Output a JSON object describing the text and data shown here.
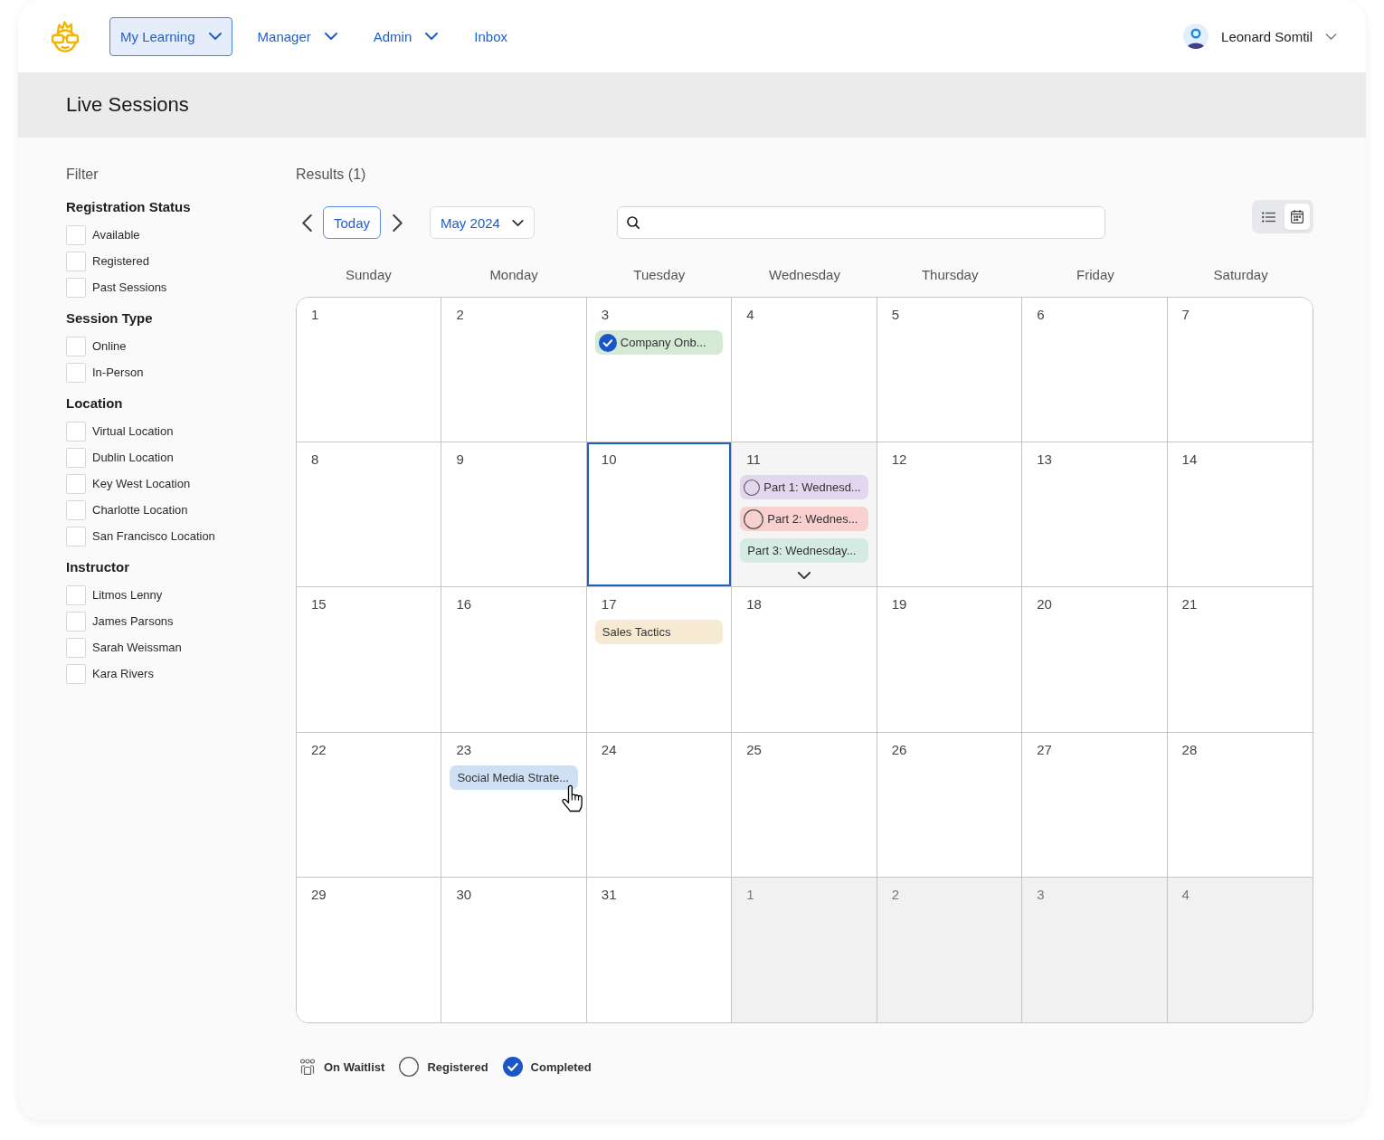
{
  "nav": {
    "items": [
      {
        "label": "My Learning",
        "dropdown": true,
        "selected": true
      },
      {
        "label": "Manager",
        "dropdown": true,
        "selected": false
      },
      {
        "label": "Admin",
        "dropdown": true,
        "selected": false
      },
      {
        "label": "Inbox",
        "dropdown": false,
        "selected": false
      }
    ],
    "user": {
      "name": "Leonard Somtil"
    }
  },
  "header": {
    "title": "Live Sessions"
  },
  "filter": {
    "heading": "Filter",
    "groups": [
      {
        "title": "Registration Status",
        "options": [
          {
            "label": "Available",
            "checked": false
          },
          {
            "label": "Registered",
            "checked": false
          },
          {
            "label": "Past Sessions",
            "checked": false
          }
        ]
      },
      {
        "title": "Session Type",
        "options": [
          {
            "label": "Online",
            "checked": false
          },
          {
            "label": "In-Person",
            "checked": false
          }
        ]
      },
      {
        "title": "Location",
        "options": [
          {
            "label": "Virtual Location",
            "checked": false
          },
          {
            "label": "Dublin Location",
            "checked": false
          },
          {
            "label": "Key West Location",
            "checked": false
          },
          {
            "label": "Charlotte Location",
            "checked": false
          },
          {
            "label": "San Francisco Location",
            "checked": false
          }
        ]
      },
      {
        "title": "Instructor",
        "options": [
          {
            "label": "Litmos Lenny",
            "checked": false
          },
          {
            "label": "James Parsons",
            "checked": false
          },
          {
            "label": "Sarah Weissman",
            "checked": false
          },
          {
            "label": "Kara Rivers",
            "checked": false
          }
        ]
      }
    ]
  },
  "results": {
    "heading": "Results (1)"
  },
  "toolbar": {
    "today": "Today",
    "month": "May 2024",
    "views": [
      {
        "kind": "list",
        "selected": false
      },
      {
        "kind": "calendar",
        "selected": true
      }
    ]
  },
  "calendar": {
    "weekdays": [
      "Sunday",
      "Monday",
      "Tuesday",
      "Wednesday",
      "Thursday",
      "Friday",
      "Saturday"
    ],
    "weeks": [
      {
        "days": [
          {
            "day": "1",
            "other_month": false,
            "selected": false,
            "more": false
          },
          {
            "day": "2",
            "other_month": false,
            "selected": false,
            "more": false
          },
          {
            "day": "3",
            "other_month": false,
            "selected": false,
            "more": false,
            "events": [
              {
                "title": "Company Onb...",
                "color": "#d4ead4",
                "kind": "completed",
                "hovered": false
              }
            ]
          },
          {
            "day": "4",
            "other_month": false,
            "selected": false,
            "more": false
          },
          {
            "day": "5",
            "other_month": false,
            "selected": false,
            "more": false
          },
          {
            "day": "6",
            "other_month": false,
            "selected": false,
            "more": false
          },
          {
            "day": "7",
            "other_month": false,
            "selected": false,
            "more": false
          }
        ]
      },
      {
        "days": [
          {
            "day": "8",
            "other_month": false,
            "selected": false,
            "more": false
          },
          {
            "day": "9",
            "other_month": false,
            "selected": false,
            "more": false
          },
          {
            "day": "10",
            "other_month": false,
            "selected": true,
            "more": false
          },
          {
            "day": "11",
            "other_month": false,
            "selected": false,
            "more": true,
            "events": [
              {
                "title": "Part 1: Wednesd...",
                "color": "#e3d7ef",
                "kind": "registered",
                "hovered": false
              },
              {
                "title": "Part 2: Wednes...",
                "color": "#f8d0d0",
                "kind": "registered",
                "hovered": false
              },
              {
                "title": "Part 3: Wednesday...",
                "color": "#d3ebe2",
                "kind": "plain",
                "hovered": false
              }
            ]
          },
          {
            "day": "12",
            "other_month": false,
            "selected": false,
            "more": false
          },
          {
            "day": "13",
            "other_month": false,
            "selected": false,
            "more": false
          },
          {
            "day": "14",
            "other_month": false,
            "selected": false,
            "more": false
          }
        ]
      },
      {
        "days": [
          {
            "day": "15",
            "other_month": false,
            "selected": false,
            "more": false
          },
          {
            "day": "16",
            "other_month": false,
            "selected": false,
            "more": false
          },
          {
            "day": "17",
            "other_month": false,
            "selected": false,
            "more": false,
            "events": [
              {
                "title": "Sales Tactics",
                "color": "#f6ebd2",
                "kind": "plain",
                "hovered": false
              }
            ]
          },
          {
            "day": "18",
            "other_month": false,
            "selected": false,
            "more": false
          },
          {
            "day": "19",
            "other_month": false,
            "selected": false,
            "more": false
          },
          {
            "day": "20",
            "other_month": false,
            "selected": false,
            "more": false
          },
          {
            "day": "21",
            "other_month": false,
            "selected": false,
            "more": false
          }
        ]
      },
      {
        "days": [
          {
            "day": "22",
            "other_month": false,
            "selected": false,
            "more": false
          },
          {
            "day": "23",
            "other_month": false,
            "selected": false,
            "more": false,
            "events": [
              {
                "title": "Social Media Strate...",
                "color": "#cfe0f4",
                "kind": "plain",
                "hovered": true
              }
            ]
          },
          {
            "day": "24",
            "other_month": false,
            "selected": false,
            "more": false
          },
          {
            "day": "25",
            "other_month": false,
            "selected": false,
            "more": false
          },
          {
            "day": "26",
            "other_month": false,
            "selected": false,
            "more": false
          },
          {
            "day": "27",
            "other_month": false,
            "selected": false,
            "more": false
          },
          {
            "day": "28",
            "other_month": false,
            "selected": false,
            "more": false
          }
        ]
      },
      {
        "days": [
          {
            "day": "29",
            "other_month": false,
            "selected": false,
            "more": false
          },
          {
            "day": "30",
            "other_month": false,
            "selected": false,
            "more": false
          },
          {
            "day": "31",
            "other_month": false,
            "selected": false,
            "more": false
          },
          {
            "day": "1",
            "other_month": true,
            "selected": false,
            "more": false
          },
          {
            "day": "2",
            "other_month": true,
            "selected": false,
            "more": false
          },
          {
            "day": "3",
            "other_month": true,
            "selected": false,
            "more": false
          },
          {
            "day": "4",
            "other_month": true,
            "selected": false,
            "more": false
          }
        ]
      }
    ]
  },
  "legend": [
    {
      "kind": "waitlist",
      "label": "On Waitlist"
    },
    {
      "kind": "registered",
      "label": "Registered"
    },
    {
      "kind": "completed",
      "label": "Completed"
    }
  ]
}
